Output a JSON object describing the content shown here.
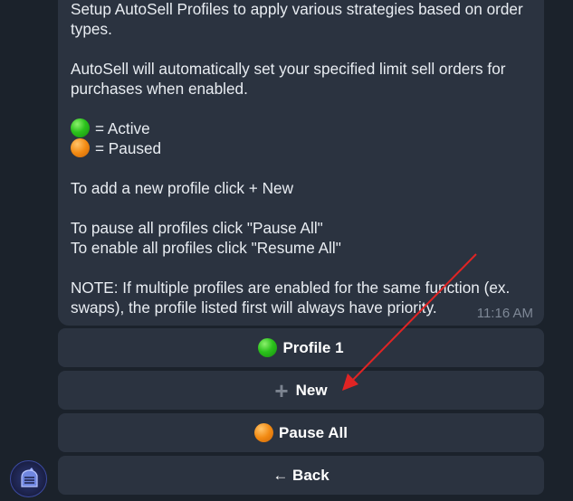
{
  "message": {
    "lines": [
      "Setup AutoSell Profiles to apply various strategies based on order",
      "types.",
      "AutoSell will automatically set your specified limit sell orders for",
      "purchases when enabled.",
      "= Active",
      "= Paused",
      "To add a new profile click + New",
      "To pause all profiles click \"Pause All\"",
      "To enable all profiles click \"Resume All\"",
      "NOTE: If multiple profiles are enabled for the same function (ex.",
      "swaps), the profile listed first will always have priority."
    ],
    "timestamp": "11:16 AM"
  },
  "buttons": {
    "profile1": "Profile 1",
    "new": "New",
    "pause_all": "Pause All",
    "back": "← Back"
  },
  "icons": {
    "active_dot": "green-circle-icon",
    "paused_dot": "orange-circle-icon",
    "plus": "plus-icon",
    "avatar": "bot-avatar"
  },
  "colors": {
    "background": "#1b222b",
    "bubble": "#2b3340",
    "active": "#2bc11c",
    "paused": "#f28a12",
    "annotation_arrow": "#e02424"
  }
}
